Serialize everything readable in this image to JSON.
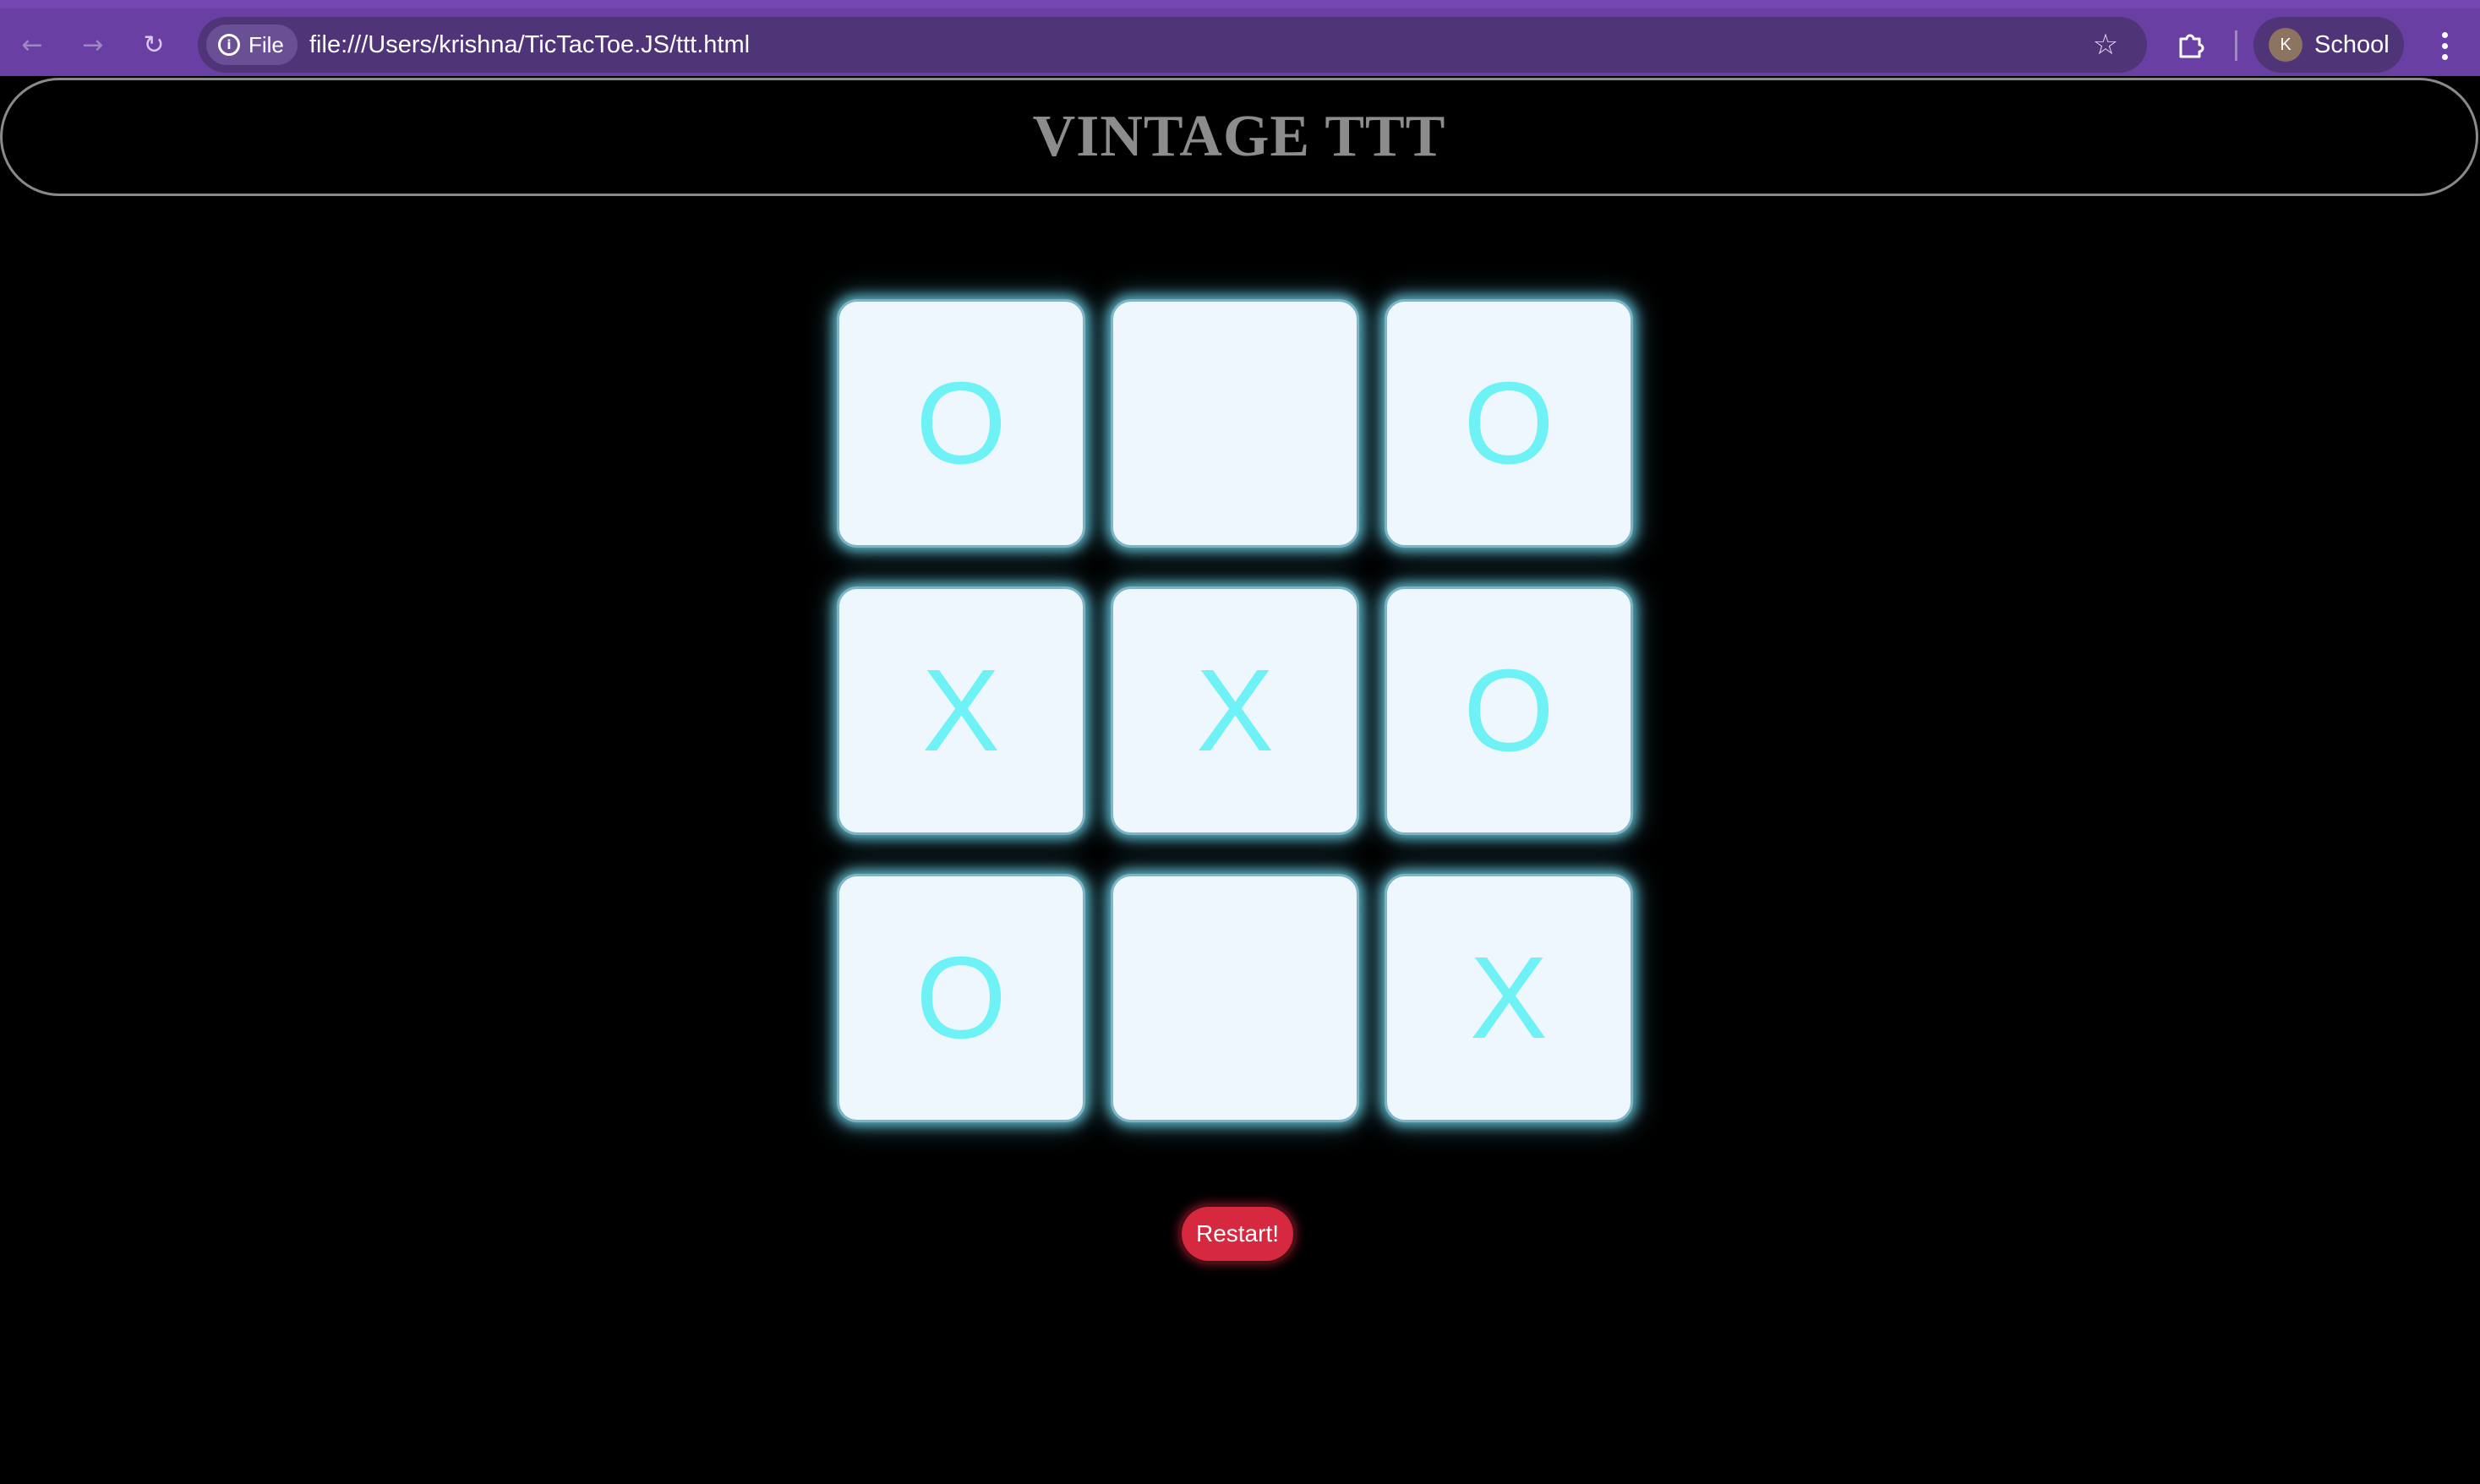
{
  "browser": {
    "site_chip_label": "File",
    "url": "file:///Users/krishna/TicTacToe.JS/ttt.html",
    "profile_initial": "K",
    "profile_name": "School",
    "icons": {
      "back": "arrow-left-icon",
      "forward": "arrow-right-icon",
      "reload": "reload-icon",
      "site_info": "info-icon",
      "bookmark": "star-icon",
      "extensions": "puzzle-icon",
      "menu": "kebab-menu-icon"
    }
  },
  "page": {
    "title": "VINTAGE TTT",
    "board": [
      {
        "mark": "O"
      },
      {
        "mark": ""
      },
      {
        "mark": "O"
      },
      {
        "mark": "X"
      },
      {
        "mark": "X"
      },
      {
        "mark": "O"
      },
      {
        "mark": "O"
      },
      {
        "mark": ""
      },
      {
        "mark": "X"
      }
    ],
    "restart_label": "Restart!"
  },
  "colors": {
    "chrome": "#6a3fa3",
    "background": "#000000",
    "title": "#8c8c8c",
    "cell_background": "#eef7fd",
    "mark": "#6ff2f6",
    "restart_button": "#d6283f"
  }
}
